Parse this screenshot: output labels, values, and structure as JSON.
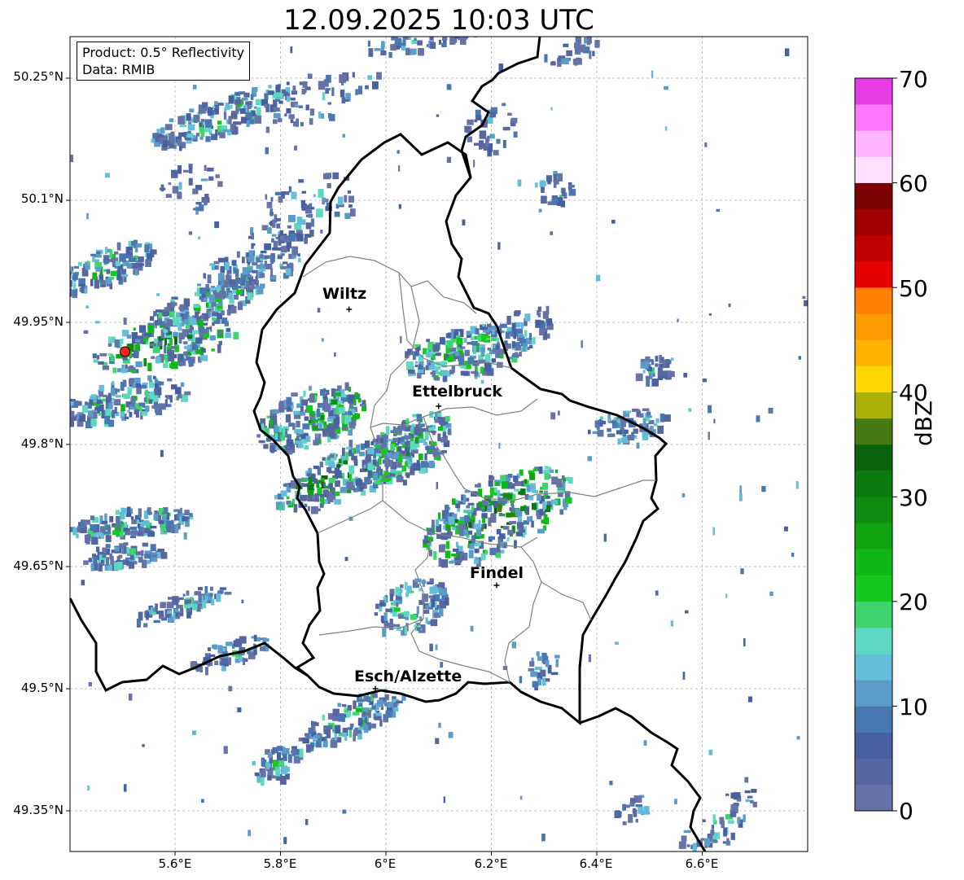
{
  "title": "12.09.2025 10:03 UTC",
  "info": {
    "product": "Product: 0.5° Reflectivity",
    "data": "Data: RMIB"
  },
  "map": {
    "lat_labels": [
      "50.25°N",
      "50.1°N",
      "49.95°N",
      "49.8°N",
      "49.65°N",
      "49.5°N",
      "49.35°N"
    ],
    "lon_labels": [
      "5.6°E",
      "5.8°E",
      "6°E",
      "6.2°E",
      "6.4°E",
      "6.6°E"
    ],
    "cities": [
      {
        "name": "Wiltz",
        "lon": 5.93,
        "lat": 49.966
      },
      {
        "name": "Ettelbruck",
        "lon": 6.1,
        "lat": 49.847
      },
      {
        "name": "Findel",
        "lon": 6.21,
        "lat": 49.627
      },
      {
        "name": "Esch/Alzette",
        "lon": 5.98,
        "lat": 49.5
      }
    ],
    "radar_site": {
      "lon": 5.505,
      "lat": 49.914,
      "color": "#ff2020"
    }
  },
  "colorbar": {
    "unit": "dBZ",
    "min": 0,
    "max": 70,
    "ticks": [
      "0",
      "10",
      "20",
      "30",
      "40",
      "50",
      "60",
      "70"
    ],
    "colors": [
      "#6573a6",
      "#5667a0",
      "#4660a2",
      "#4877b1",
      "#5a9bc7",
      "#63bdd9",
      "#5ed8c2",
      "#3fd46e",
      "#14c81e",
      "#10b816",
      "#0fa312",
      "#0d8c10",
      "#0b7a0e",
      "#0a620c",
      "#467a12",
      "#aab20a",
      "#ffd700",
      "#ffb200",
      "#ff9a00",
      "#ff7f00",
      "#e60000",
      "#c00000",
      "#a20000",
      "#7c0000",
      "#ffe1ff",
      "#ffb4ff",
      "#ff78ff",
      "#e63ce6"
    ]
  }
}
